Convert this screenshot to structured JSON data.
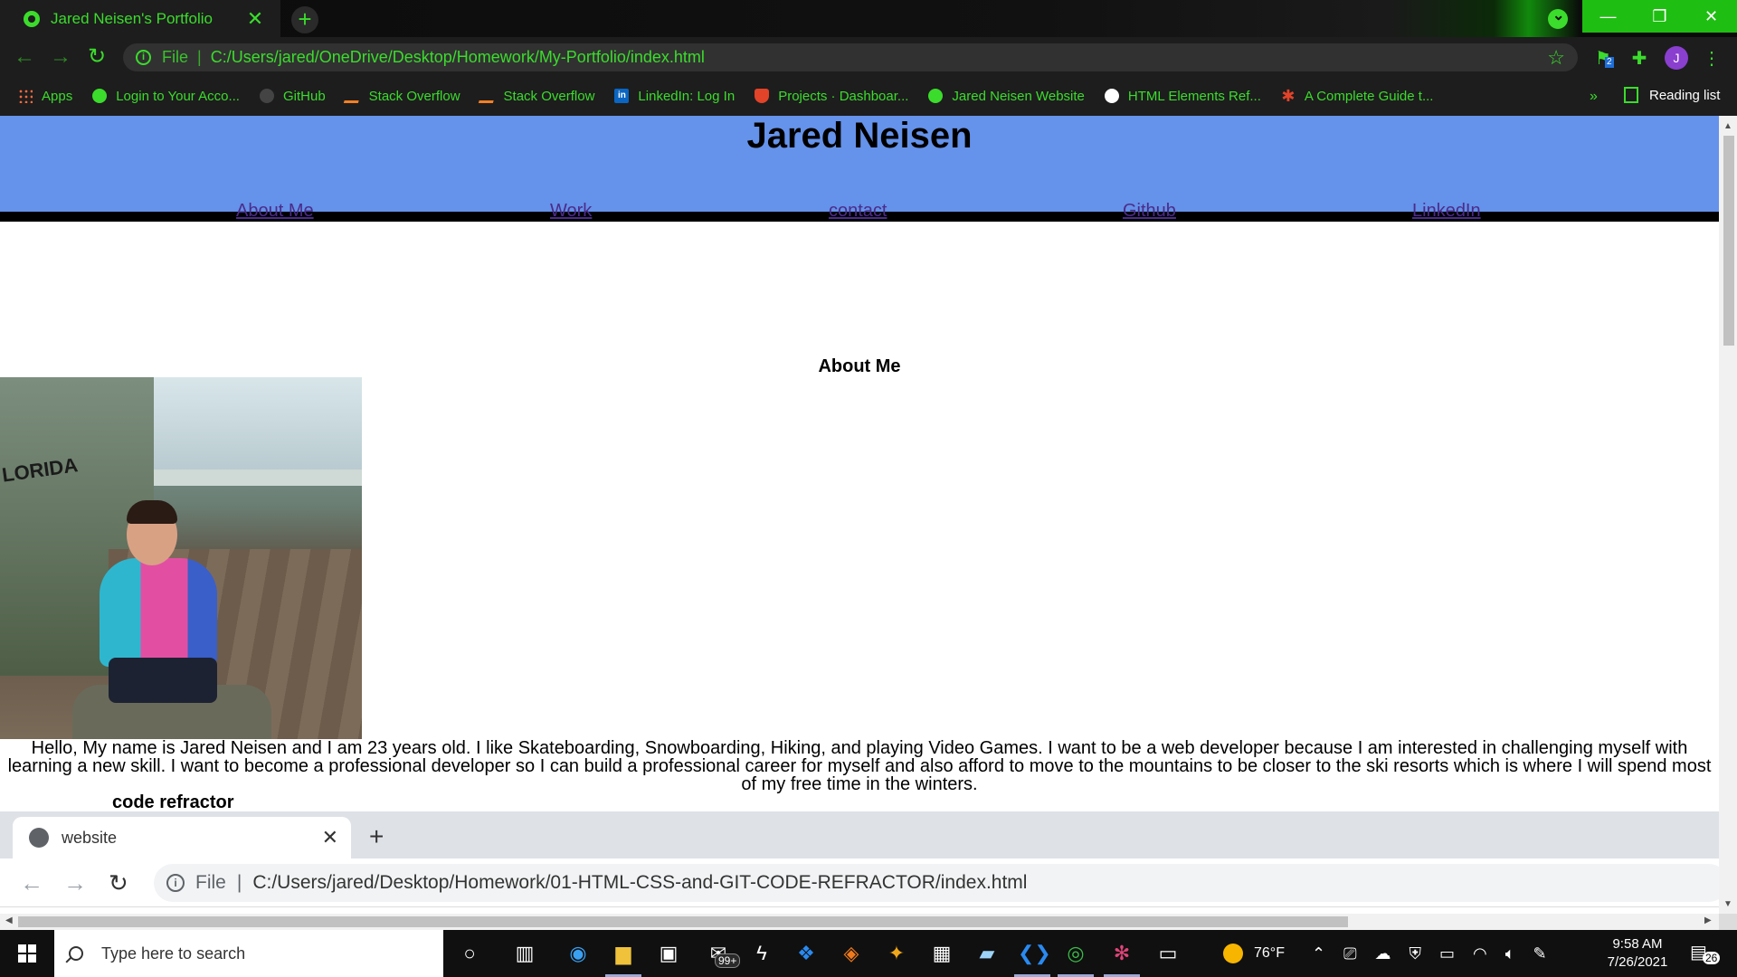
{
  "browser": {
    "tab": {
      "title": "Jared Neisen's Portfolio",
      "close": "✕"
    },
    "new_tab": "+",
    "url_scheme": "File",
    "url": "C:/Users/jared/OneDrive/Desktop/Homework/My-Portfolio/index.html",
    "extension_badge": "2",
    "profile_initial": "J",
    "bookmarks": [
      {
        "label": "Apps",
        "icon": "apps-icon"
      },
      {
        "label": "Login to Your Acco...",
        "icon": "globe-icon"
      },
      {
        "label": "GitHub",
        "icon": "github-icon"
      },
      {
        "label": "Stack Overflow",
        "icon": "stackoverflow-icon"
      },
      {
        "label": "Stack Overflow",
        "icon": "stackoverflow-icon"
      },
      {
        "label": "LinkedIn: Log In",
        "icon": "linkedin-icon"
      },
      {
        "label": "Projects · Dashboar...",
        "icon": "gitlab-icon"
      },
      {
        "label": "Jared Neisen Website",
        "icon": "globe-icon"
      },
      {
        "label": "HTML Elements Ref...",
        "icon": "mdn-icon"
      },
      {
        "label": "A Complete Guide t...",
        "icon": "star-icon"
      }
    ],
    "bookmarks_more": "»",
    "reading_list": "Reading list"
  },
  "page": {
    "title": "Jared Neisen",
    "nav": [
      "About Me",
      "Work",
      "contact",
      "Github",
      "LinkedIn"
    ],
    "about_heading": "About Me",
    "photo_text": "LORIDA",
    "about_text": "Hello, My name is Jared Neisen and I am 23 years old. I like Skateboarding, Snowboarding, Hiking, and playing Video Games. I want to be a web developer because I am interested in challenging myself with learning a new skill. I want to become a professional developer so I can build a professional career for myself and also afford to move to the mountains to be closer to the ski resorts which is where I will spend most of my free time in the winters.",
    "project_title": "code refractor",
    "project_screenshot": {
      "tab_title": "website",
      "url_scheme": "File",
      "url": "C:/Users/jared/Desktop/Homework/01-HTML-CSS-and-GIT-CODE-REFRACTOR/index.html"
    }
  },
  "taskbar": {
    "search_placeholder": "Type here to search",
    "mail_badge": "99+",
    "weather": "76°F",
    "time": "9:58 AM",
    "date": "7/26/2021",
    "notifications": "26"
  },
  "colors": {
    "chrome_accent": "#3bdc2c",
    "header_blue": "#6592ea",
    "link_purple": "#4b2c8a"
  }
}
